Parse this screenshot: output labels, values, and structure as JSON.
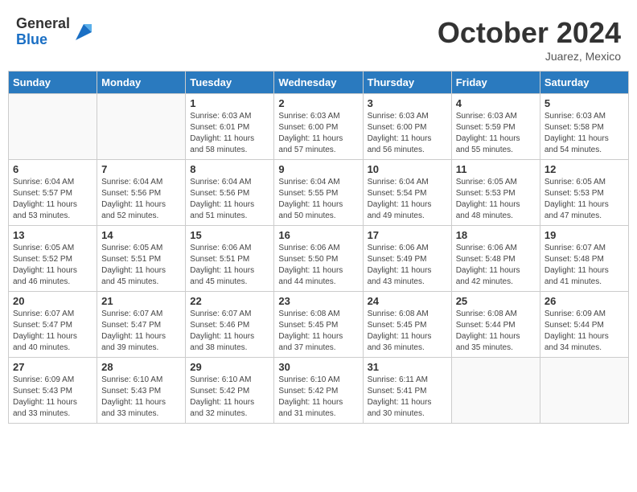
{
  "header": {
    "logo_general": "General",
    "logo_blue": "Blue",
    "month_title": "October 2024",
    "subtitle": "Juarez, Mexico"
  },
  "days_of_week": [
    "Sunday",
    "Monday",
    "Tuesday",
    "Wednesday",
    "Thursday",
    "Friday",
    "Saturday"
  ],
  "weeks": [
    [
      {
        "day": "",
        "info": ""
      },
      {
        "day": "",
        "info": ""
      },
      {
        "day": "1",
        "info": "Sunrise: 6:03 AM\nSunset: 6:01 PM\nDaylight: 11 hours and 58 minutes."
      },
      {
        "day": "2",
        "info": "Sunrise: 6:03 AM\nSunset: 6:00 PM\nDaylight: 11 hours and 57 minutes."
      },
      {
        "day": "3",
        "info": "Sunrise: 6:03 AM\nSunset: 6:00 PM\nDaylight: 11 hours and 56 minutes."
      },
      {
        "day": "4",
        "info": "Sunrise: 6:03 AM\nSunset: 5:59 PM\nDaylight: 11 hours and 55 minutes."
      },
      {
        "day": "5",
        "info": "Sunrise: 6:03 AM\nSunset: 5:58 PM\nDaylight: 11 hours and 54 minutes."
      }
    ],
    [
      {
        "day": "6",
        "info": "Sunrise: 6:04 AM\nSunset: 5:57 PM\nDaylight: 11 hours and 53 minutes."
      },
      {
        "day": "7",
        "info": "Sunrise: 6:04 AM\nSunset: 5:56 PM\nDaylight: 11 hours and 52 minutes."
      },
      {
        "day": "8",
        "info": "Sunrise: 6:04 AM\nSunset: 5:56 PM\nDaylight: 11 hours and 51 minutes."
      },
      {
        "day": "9",
        "info": "Sunrise: 6:04 AM\nSunset: 5:55 PM\nDaylight: 11 hours and 50 minutes."
      },
      {
        "day": "10",
        "info": "Sunrise: 6:04 AM\nSunset: 5:54 PM\nDaylight: 11 hours and 49 minutes."
      },
      {
        "day": "11",
        "info": "Sunrise: 6:05 AM\nSunset: 5:53 PM\nDaylight: 11 hours and 48 minutes."
      },
      {
        "day": "12",
        "info": "Sunrise: 6:05 AM\nSunset: 5:53 PM\nDaylight: 11 hours and 47 minutes."
      }
    ],
    [
      {
        "day": "13",
        "info": "Sunrise: 6:05 AM\nSunset: 5:52 PM\nDaylight: 11 hours and 46 minutes."
      },
      {
        "day": "14",
        "info": "Sunrise: 6:05 AM\nSunset: 5:51 PM\nDaylight: 11 hours and 45 minutes."
      },
      {
        "day": "15",
        "info": "Sunrise: 6:06 AM\nSunset: 5:51 PM\nDaylight: 11 hours and 45 minutes."
      },
      {
        "day": "16",
        "info": "Sunrise: 6:06 AM\nSunset: 5:50 PM\nDaylight: 11 hours and 44 minutes."
      },
      {
        "day": "17",
        "info": "Sunrise: 6:06 AM\nSunset: 5:49 PM\nDaylight: 11 hours and 43 minutes."
      },
      {
        "day": "18",
        "info": "Sunrise: 6:06 AM\nSunset: 5:48 PM\nDaylight: 11 hours and 42 minutes."
      },
      {
        "day": "19",
        "info": "Sunrise: 6:07 AM\nSunset: 5:48 PM\nDaylight: 11 hours and 41 minutes."
      }
    ],
    [
      {
        "day": "20",
        "info": "Sunrise: 6:07 AM\nSunset: 5:47 PM\nDaylight: 11 hours and 40 minutes."
      },
      {
        "day": "21",
        "info": "Sunrise: 6:07 AM\nSunset: 5:47 PM\nDaylight: 11 hours and 39 minutes."
      },
      {
        "day": "22",
        "info": "Sunrise: 6:07 AM\nSunset: 5:46 PM\nDaylight: 11 hours and 38 minutes."
      },
      {
        "day": "23",
        "info": "Sunrise: 6:08 AM\nSunset: 5:45 PM\nDaylight: 11 hours and 37 minutes."
      },
      {
        "day": "24",
        "info": "Sunrise: 6:08 AM\nSunset: 5:45 PM\nDaylight: 11 hours and 36 minutes."
      },
      {
        "day": "25",
        "info": "Sunrise: 6:08 AM\nSunset: 5:44 PM\nDaylight: 11 hours and 35 minutes."
      },
      {
        "day": "26",
        "info": "Sunrise: 6:09 AM\nSunset: 5:44 PM\nDaylight: 11 hours and 34 minutes."
      }
    ],
    [
      {
        "day": "27",
        "info": "Sunrise: 6:09 AM\nSunset: 5:43 PM\nDaylight: 11 hours and 33 minutes."
      },
      {
        "day": "28",
        "info": "Sunrise: 6:10 AM\nSunset: 5:43 PM\nDaylight: 11 hours and 33 minutes."
      },
      {
        "day": "29",
        "info": "Sunrise: 6:10 AM\nSunset: 5:42 PM\nDaylight: 11 hours and 32 minutes."
      },
      {
        "day": "30",
        "info": "Sunrise: 6:10 AM\nSunset: 5:42 PM\nDaylight: 11 hours and 31 minutes."
      },
      {
        "day": "31",
        "info": "Sunrise: 6:11 AM\nSunset: 5:41 PM\nDaylight: 11 hours and 30 minutes."
      },
      {
        "day": "",
        "info": ""
      },
      {
        "day": "",
        "info": ""
      }
    ]
  ]
}
